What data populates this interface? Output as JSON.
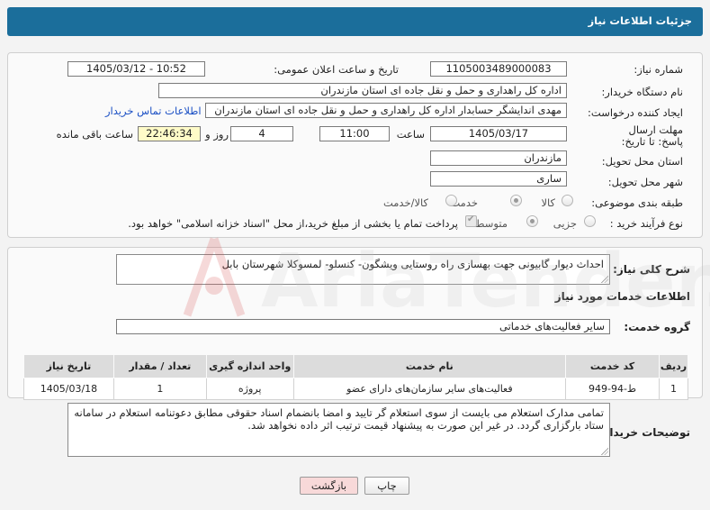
{
  "header": {
    "title": "جزئیات اطلاعات نیاز"
  },
  "form": {
    "need_number_label": "شماره نیاز:",
    "need_number": "1105003489000083",
    "announce_label": "تاریخ و ساعت اعلان عمومی:",
    "announce_value": "1405/03/12 - 10:52",
    "buyer_label": "نام دستگاه خریدار:",
    "buyer_value": "اداره کل راهداری و حمل و نقل جاده ای استان مازندران",
    "creator_label": "ایجاد کننده درخواست:",
    "creator_value": "مهدی اندایشگر حسابدار اداره کل راهداری و حمل و نقل جاده ای استان مازندران",
    "contact_link": "اطلاعات تماس خریدار",
    "deadline_label": "مهلت ارسال پاسخ: تا تاریخ:",
    "deadline_date": "1405/03/17",
    "time_label": "ساعت",
    "deadline_time": "11:00",
    "days_value": "4",
    "days_label": "روز و",
    "remaining_value": "22:46:34",
    "remaining_label": "ساعت باقی مانده",
    "province_label": "استان محل تحویل:",
    "province_value": "مازندران",
    "city_label": "شهر محل تحویل:",
    "city_value": "ساری",
    "category_label": "طبقه بندی موضوعی:",
    "category_options": [
      "کالا",
      "خدمت",
      "کالا/خدمت"
    ],
    "category_selected": "خدمت",
    "process_label": "نوع فرآیند خرید :",
    "process_options": [
      "جزیی",
      "متوسط"
    ],
    "process_selected": "متوسط",
    "payment_note": "پرداخت تمام یا بخشی از مبلغ خرید،از محل \"اسناد خزانه اسلامی\" خواهد بود."
  },
  "description": {
    "label": "شرح کلی نیاز:",
    "value": "احداث دیوار گابیونی جهت بهسازی راه روستایی ویشگون- کنسلو- لمسوکلا شهرستان بابل"
  },
  "services": {
    "section_title": "اطلاعات خدمات مورد نیاز",
    "group_label": "گروه خدمت:",
    "group_value": "سایر فعالیت‌های خدماتی",
    "columns": [
      "ردیف",
      "کد خدمت",
      "نام خدمت",
      "واحد اندازه گیری",
      "تعداد / مقدار",
      "تاریخ نیاز"
    ],
    "rows": [
      {
        "row": "1",
        "code": "ط-94-949",
        "name": "فعالیت‌های سایر سازمان‌های دارای عضو",
        "unit": "پروژه",
        "qty": "1",
        "date": "1405/03/18"
      }
    ]
  },
  "notes": {
    "label": "توضیحات خریدار:",
    "value": "تمامی مدارک استعلام می بایست از سوی استعلام گر تایید و امضا بانضمام اسناد حقوقی مطابق دعوتنامه استعلام در سامانه ستاد بارگزاری گردد. در غیر این صورت به پیشنهاد قیمت ترتیب اثر داده نخواهد شد."
  },
  "buttons": {
    "print": "چاپ",
    "back": "بازگشت"
  },
  "watermark": {
    "text": "AriaTender.net"
  },
  "colors": {
    "header": "#1b6e9b",
    "link": "#1a4fc4",
    "highlight": "#fffbc8",
    "back_button": "#f8d9d9"
  }
}
